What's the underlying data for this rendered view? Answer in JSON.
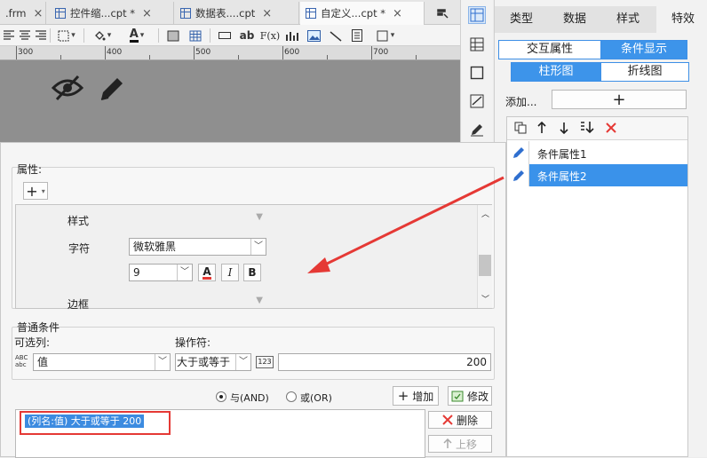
{
  "tabs": [
    {
      "label": ".frm",
      "close": "×"
    },
    {
      "label": "控件缩...cpt *",
      "close": "×"
    },
    {
      "label": "数据表....cpt",
      "close": "×"
    },
    {
      "label": "自定义...cpt *",
      "close": "×"
    }
  ],
  "toolbar": {
    "font_color_letter": "A",
    "ab_label": "ab",
    "fx_label": "F(x)"
  },
  "ruler": {
    "marks": [
      "300",
      "400",
      "500",
      "600",
      "700"
    ]
  },
  "right_panel": {
    "tabs": [
      "类型",
      "数据",
      "样式",
      "特效"
    ],
    "seg1": [
      "交互属性",
      "条件显示"
    ],
    "seg2": [
      "柱形图",
      "折线图"
    ],
    "add_label": "添加...",
    "add_button": "+",
    "list": [
      {
        "label": "条件属性1",
        "selected": false
      },
      {
        "label": "条件属性2",
        "selected": true
      }
    ]
  },
  "dialog": {
    "attr_group_title": "属性:",
    "style_label": "样式",
    "char_label": "字符",
    "font_name": "微软雅黑",
    "font_size": "9",
    "bold_letter": "B",
    "italic_letter": "I",
    "color_letter": "A",
    "border_label": "边框",
    "cond_group_title": "普通条件",
    "column_label": "可选列:",
    "operator_label": "操作符:",
    "column_value": "值",
    "operator_value": "大于或等于",
    "value_type_icon": "123",
    "value": "200",
    "and_label": "与(AND)",
    "or_label": "或(OR)",
    "add_button": "增加",
    "modify_button": "修改",
    "delete_button": "删除",
    "up_button": "上移",
    "condition_item": "(列名:值) 大于或等于  200"
  },
  "colors": {
    "accent": "#3d94ea",
    "highlight": "#e53935",
    "selected_row": "#3a92ea"
  }
}
